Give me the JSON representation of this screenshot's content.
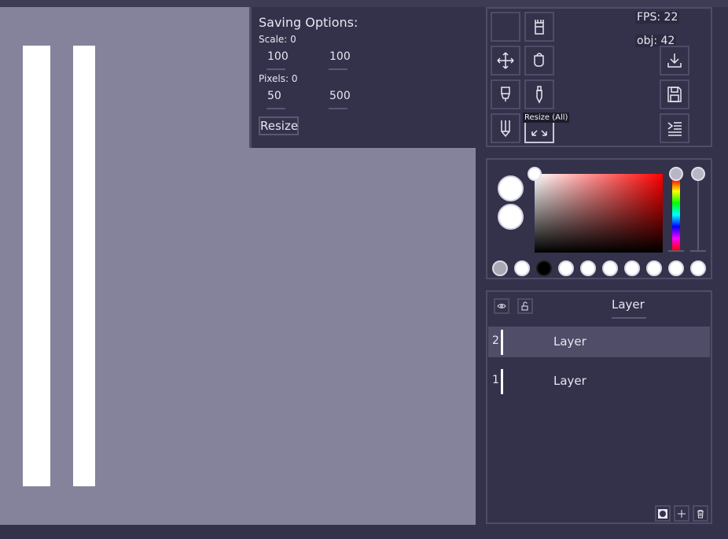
{
  "saving_options": {
    "title": "Saving Options:",
    "scale_label": "Scale: 0",
    "scale_x": "100",
    "scale_y": "100",
    "pixels_label": "Pixels: 0",
    "pixels_x": "50",
    "pixels_y": "500",
    "resize_button": "Resize"
  },
  "stats": {
    "fps": "FPS: 22",
    "obj": "obj: 42"
  },
  "tooltip": "Resize (All)",
  "tools": [
    {
      "icon": "empty-slot-icon"
    },
    {
      "icon": "eraser-icon"
    },
    {
      "icon": "move-icon"
    },
    {
      "icon": "fill-bucket-icon"
    },
    {
      "icon": "brush-icon"
    },
    {
      "icon": "eyedropper-icon"
    },
    {
      "icon": "pencil-icon"
    },
    {
      "icon": "resize-icon",
      "active": true
    }
  ],
  "side_actions": [
    {
      "icon": "download-icon"
    },
    {
      "icon": "save-icon"
    },
    {
      "icon": "list-icon"
    }
  ],
  "colors": {
    "primary": "#ffffff",
    "secondary": "#ffffff",
    "palette": [
      "#a9a7b3",
      "#ffffff",
      "#000000",
      "#ffffff",
      "#ffffff",
      "#ffffff",
      "#ffffff",
      "#ffffff",
      "#ffffff",
      "#ffffff"
    ]
  },
  "layers_panel": {
    "header": "Layer",
    "layers": [
      {
        "index": "2",
        "name": "Layer",
        "selected": true
      },
      {
        "index": "1",
        "name": "Layer",
        "selected": false
      }
    ]
  }
}
